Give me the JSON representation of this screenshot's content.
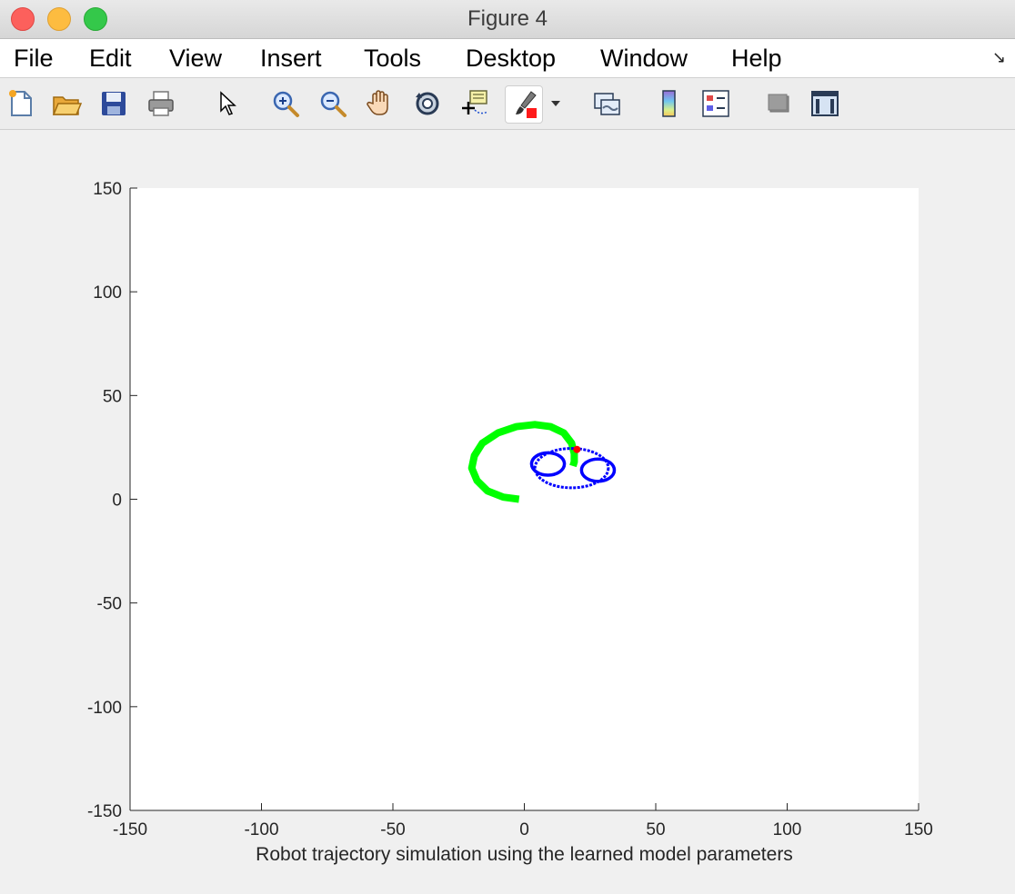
{
  "window": {
    "title": "Figure 4"
  },
  "menu": [
    "File",
    "Edit",
    "View",
    "Insert",
    "Tools",
    "Desktop",
    "Window",
    "Help"
  ],
  "toolbar": [
    "new-figure-icon",
    "open-file-icon",
    "save-icon",
    "print-icon",
    "edit-plot-cursor-icon",
    "zoom-in-icon",
    "zoom-out-icon",
    "pan-hand-icon",
    "rotate-3d-icon",
    "data-cursor-icon",
    "brush-icon",
    "brush-dropdown-icon",
    "link-plot-icon",
    "colorbar-icon",
    "legend-icon",
    "hide-plot-tools-icon",
    "show-plot-tools-icon"
  ],
  "colors": {
    "trajectory": "#00ff00",
    "robot_body": "#0000ff",
    "robot_marker": "#ff0000"
  },
  "chart_data": {
    "type": "line",
    "xlabel": "Robot trajectory simulation using the learned model parameters",
    "xlim": [
      -150,
      150
    ],
    "ylim": [
      -150,
      150
    ],
    "xticks": [
      "-150",
      "-100",
      "-50",
      "0",
      "50",
      "100",
      "150"
    ],
    "yticks": [
      "150",
      "100",
      "50",
      "0",
      "-50",
      "-100",
      "-150"
    ],
    "grid": false,
    "series": [
      {
        "style": "trajectory",
        "x": [
          -2,
          -8,
          -14,
          -18,
          -20,
          -19,
          -16,
          -10,
          -3,
          4,
          10,
          15,
          18,
          19,
          19,
          18.5
        ],
        "y": [
          0,
          1,
          4,
          9,
          15,
          21,
          27,
          32,
          35,
          36,
          35,
          32,
          27,
          22,
          18,
          16
        ]
      }
    ],
    "robot": {
      "body_center": [
        18,
        15
      ],
      "body_radii": [
        9,
        10
      ],
      "wheels": [
        {
          "center": [
            9,
            17
          ],
          "radii": [
            2.5,
            5
          ]
        },
        {
          "center": [
            28,
            14
          ],
          "radii": [
            2.5,
            5
          ]
        }
      ],
      "marker": [
        20,
        24
      ]
    }
  }
}
